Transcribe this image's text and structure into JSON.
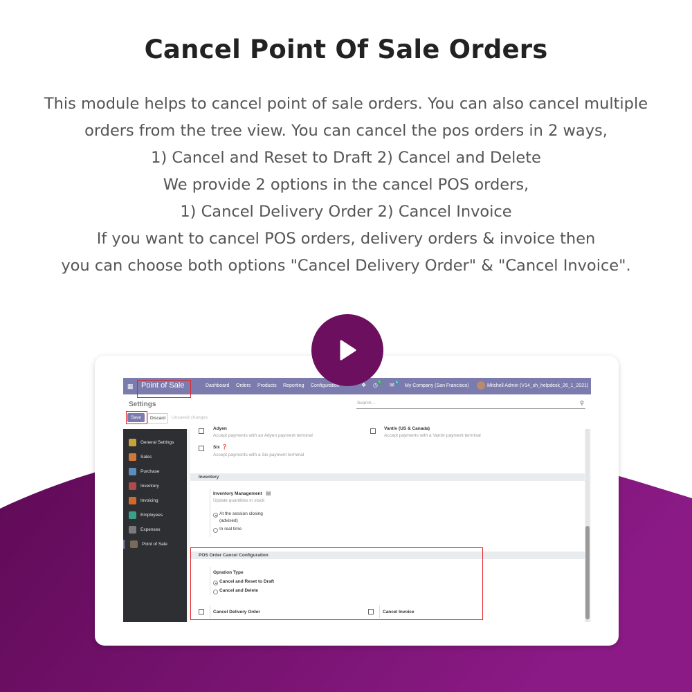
{
  "headline": "Cancel Point Of Sale Orders",
  "description_lines": [
    "This module helps to cancel point of sale orders. You can also cancel multiple",
    "orders  from the tree view. You can cancel the pos orders in 2 ways,",
    "1) Cancel and Reset to Draft   2) Cancel and Delete",
    "We provide 2 options in the cancel POS orders,",
    "1) Cancel Delivery Order 2) Cancel Invoice",
    "If you want to cancel POS orders, delivery orders & invoice then",
    "you can choose both options \"Cancel Delivery Order\" & \"Cancel Invoice\"."
  ],
  "colors": {
    "brand_purple": "#6b0f5e",
    "navbar": "#7c7bad",
    "highlight_red": "#e0252b",
    "gradient_start": "#5e0a55",
    "gradient_end": "#8b1a86"
  },
  "play_button": {
    "icon": "play-icon"
  },
  "screenshot": {
    "navbar": {
      "app_title": "Point of Sale",
      "menu": [
        "Dashboard",
        "Orders",
        "Products",
        "Reporting",
        "Configuration"
      ],
      "activity_count": "5",
      "message_count": "4",
      "company": "My Company (San Francisco)",
      "user": "Mitchell Admin (V14_sh_helpdesk_26_1_2021)"
    },
    "header": {
      "title": "Settings",
      "search_placeholder": "Search...",
      "save_label": "Save",
      "discard_label": "Discard",
      "unsaved_label": "Unsaved changes"
    },
    "sidebar": {
      "items": [
        {
          "label": "General Settings",
          "icon": "gear-icon",
          "color": "#c8a33a"
        },
        {
          "label": "Sales",
          "icon": "sales-chart-icon",
          "color": "#d0783a"
        },
        {
          "label": "Purchase",
          "icon": "purchase-icon",
          "color": "#5b8db8"
        },
        {
          "label": "Inventory",
          "icon": "inventory-box-icon",
          "color": "#b04a4a"
        },
        {
          "label": "Invoicing",
          "icon": "invoice-icon",
          "color": "#d06a2a"
        },
        {
          "label": "Employees",
          "icon": "employees-icon",
          "color": "#3aa08a"
        },
        {
          "label": "Expenses",
          "icon": "expenses-icon",
          "color": "#7a7a7a"
        },
        {
          "label": "Point of Sale",
          "icon": "pos-icon",
          "color": "#7a6a5a"
        }
      ]
    },
    "content": {
      "adyen_title": "Adyen",
      "adyen_desc": "Accept payments with an Adyen payment terminal",
      "vantiv_title": "Vantiv (US & Canada)",
      "vantiv_desc": "Accept payments with a Vantiv payment terminal",
      "six_title": "Six",
      "six_desc": "Accept payments with a Six payment terminal",
      "inventory_section": "Inventory",
      "inventory_mgmt_title": "Inventory Management",
      "inventory_mgmt_desc": "Update quantities in stock",
      "option_closing_line1": "At the session closing",
      "option_closing_line2": "(advised)",
      "option_realtime": "In real time",
      "pos_cancel_section": "POS Order Cancel Configuration",
      "operation_type_title": "Opration Type",
      "cancel_reset_option": "Cancel and Reset to Draft",
      "cancel_delete_option": "Cancel and Delete",
      "cancel_delivery_label": "Cancel Delivery Order",
      "cancel_invoice_label": "Cancel Invoice"
    }
  }
}
